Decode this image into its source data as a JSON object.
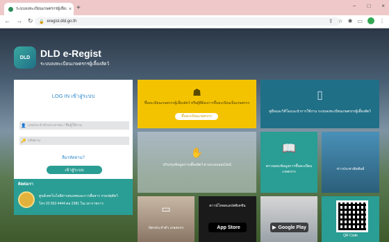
{
  "browser": {
    "tab_title": "ระบบลงทะเบียนเกษตรกรผู้เลี้ยงสัตว์",
    "tab_close": "×",
    "new_tab": "+",
    "url": "eregist.dld.go.th",
    "window_controls": [
      "−",
      "□",
      "×"
    ]
  },
  "brand": {
    "logo_text": "DLD",
    "title": "DLD e-Regist",
    "subtitle": "ระบบลงทะเบียนเกษตรกรผู้เลี้ยงสัตว์"
  },
  "login": {
    "title": "LOG IN เข้าสู่ระบบ",
    "username_placeholder": "เลขประจำตัวประชาชน / ชื่อผู้ใช้งาน",
    "password_placeholder": "รหัสผ่าน",
    "forgot": "ลืมรหัสผ่าน?",
    "submit": "เข้าสู่ระบบ"
  },
  "contact": {
    "heading": "ติดต่อเรา",
    "org": "ศูนย์เทคโนโลยีสารสนเทศและการสื่อสาร กรมปศุสัตว์",
    "phone": "โทร 02 653 4444 ต่อ 2381 ในเวลาราชการ"
  },
  "tiles": {
    "register": {
      "text": "ขึ้นทะเบียนเกษตรกรผู้เลี้ยงสัตว์ หรือผู้ที่ต้องการขึ้นทะเบียนเป็นเกษตรกร",
      "button": "ขึ้นทะเบียนเกษตรกร"
    },
    "manual": {
      "text": "คู่มือและวิดีโอแนะนำการใช้งาน ระบบลงทะเบียนเกษตรกรผู้เลี้ยงสัตว์"
    },
    "update": {
      "text": "ปรับปรุงข้อมูลการเลี้ยงสัตว์ ผ่านระบบออนไลน์"
    },
    "check": {
      "text": "ตรวจสอบข้อมูลการขึ้นทะเบียน เกษตรกร"
    },
    "news": {
      "text": "ข่าวประชาสัมพันธ์"
    },
    "card": {
      "text": "บัตรประจำตัว เกษตรกร"
    },
    "appstore": {
      "text": "ดาวน์โหลดแอปพลิเคชัน",
      "badge": "App Store"
    },
    "googleplay": {
      "badge": "Google Play"
    },
    "qr": {
      "text": "QR Code"
    }
  },
  "icons": [
    "shield-icon",
    "reload-icon",
    "back-icon",
    "forward-icon",
    "lock-icon",
    "user-icon",
    "key-icon",
    "apple-icon",
    "book-icon",
    "person-icon",
    "phone-icon"
  ]
}
